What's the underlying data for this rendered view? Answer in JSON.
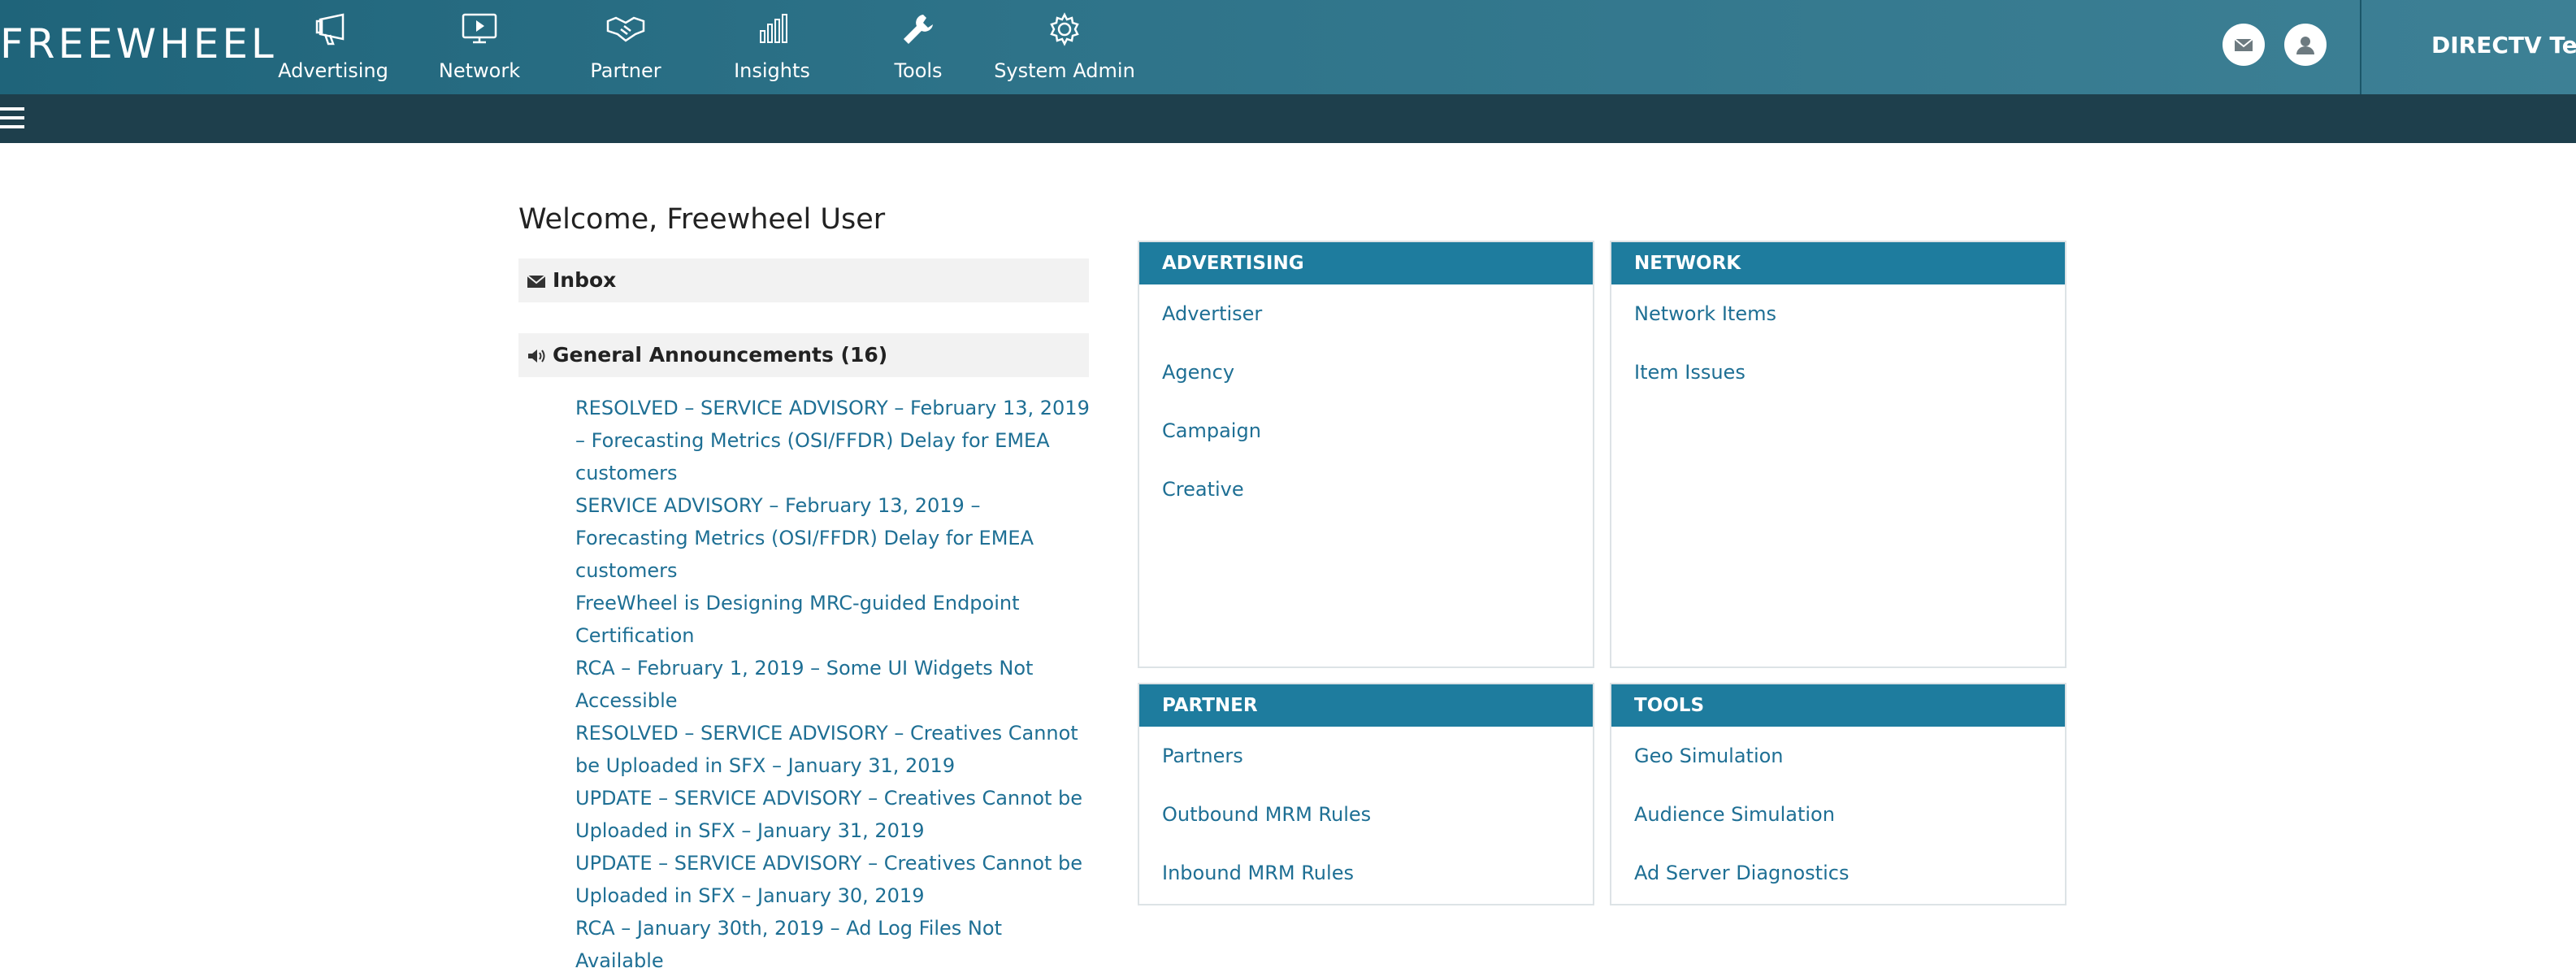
{
  "app": {
    "logo_text": "FREEWHEEL",
    "org_name": "DIRECTV Test"
  },
  "nav": {
    "items": [
      {
        "label": "Advertising",
        "icon": "megaphone-icon"
      },
      {
        "label": "Network",
        "icon": "play-screen-icon"
      },
      {
        "label": "Partner",
        "icon": "handshake-icon"
      },
      {
        "label": "Insights",
        "icon": "bar-chart-icon"
      },
      {
        "label": "Tools",
        "icon": "wrench-icon"
      },
      {
        "label": "System Admin",
        "icon": "gear-icon"
      }
    ],
    "mail_icon": "envelope-icon",
    "user_icon": "user-icon"
  },
  "colors": {
    "topbar": "#2e7389",
    "subbar": "#1e3f4c",
    "card_header": "#1e7c9e",
    "link": "#1e6f94"
  },
  "main": {
    "welcome": "Welcome, Freewheel User",
    "inbox_label": "Inbox",
    "announcements_label": "General Announcements (16)",
    "announcements": [
      "RESOLVED – SERVICE ADVISORY – February 13, 2019 – Forecasting Metrics (OSI/FFDR) Delay for EMEA customers",
      "SERVICE ADVISORY – February 13, 2019 – Forecasting Metrics (OSI/FFDR) Delay for EMEA customers",
      "FreeWheel is Designing MRC-guided Endpoint Certification",
      "RCA – February 1, 2019 – Some UI Widgets Not Accessible",
      "RESOLVED – SERVICE ADVISORY – Creatives Cannot be Uploaded in SFX – January 31, 2019",
      "UPDATE – SERVICE ADVISORY – Creatives Cannot be Uploaded in SFX – January 31, 2019",
      "UPDATE – SERVICE ADVISORY – Creatives Cannot be Uploaded in SFX – January 30, 2019",
      "RCA – January 30th, 2019 – Ad Log Files Not Available"
    ]
  },
  "cards": {
    "advertising": {
      "title": "ADVERTISING",
      "links": [
        "Advertiser",
        "Agency",
        "Campaign",
        "Creative"
      ]
    },
    "network": {
      "title": "NETWORK",
      "links": [
        "Network Items",
        "Item Issues"
      ]
    },
    "partner": {
      "title": "PARTNER",
      "links": [
        "Partners",
        "Outbound MRM Rules",
        "Inbound MRM Rules"
      ]
    },
    "tools": {
      "title": "TOOLS",
      "links": [
        "Geo Simulation",
        "Audience Simulation",
        "Ad Server Diagnostics"
      ]
    }
  }
}
